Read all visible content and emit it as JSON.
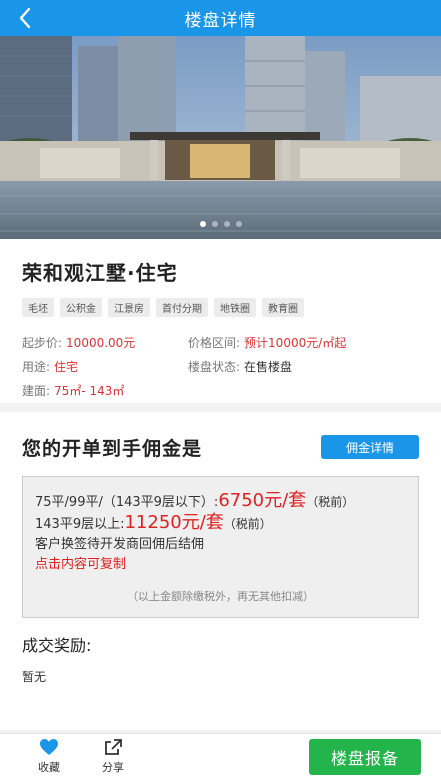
{
  "header": {
    "title": "楼盘详情",
    "back_icon": "chevron-left-icon"
  },
  "banner": {
    "slide_count": 4,
    "active_slide": 1
  },
  "project": {
    "name": "荣和观江墅·住宅",
    "tags": [
      "毛坯",
      "公积金",
      "江景房",
      "首付分期",
      "地铁圈",
      "教育圈"
    ],
    "fields": {
      "start_price_label": "起步价:",
      "start_price_value": "10000.00元",
      "price_range_label": "价格区间:",
      "price_range_value": "预计10000元/㎡起",
      "usage_label": "用途:",
      "usage_value": "住宅",
      "status_label": "楼盘状态:",
      "status_value": "在售楼盘",
      "area_label": "建面:",
      "area_value": "75㎡- 143㎡"
    }
  },
  "commission": {
    "heading": "您的开单到手佣金是",
    "detail_button": "佣金详情",
    "line1_prefix": "75平/99平/（143平9层以下）:",
    "line1_amount": "6750元/套",
    "line1_suffix": "（税前）",
    "line2_prefix": "143平9层以上:",
    "line2_amount": "11250元/套",
    "line2_suffix": "（税前）",
    "line3": "客户换签待开发商回佣后结佣",
    "copy_hint": "点击内容可复制",
    "note": "（以上金额除缴税外，再无其他扣减）"
  },
  "reward": {
    "title": "成交奖励:",
    "value": "暂无"
  },
  "footer": {
    "favorite_label": "收藏",
    "favorite_icon": "heart-icon",
    "share_label": "分享",
    "share_icon": "share-icon",
    "report_button": "楼盘报备"
  },
  "colors": {
    "primary": "#1996e8",
    "price_red": "#e02020",
    "report_green": "#23b54b"
  }
}
